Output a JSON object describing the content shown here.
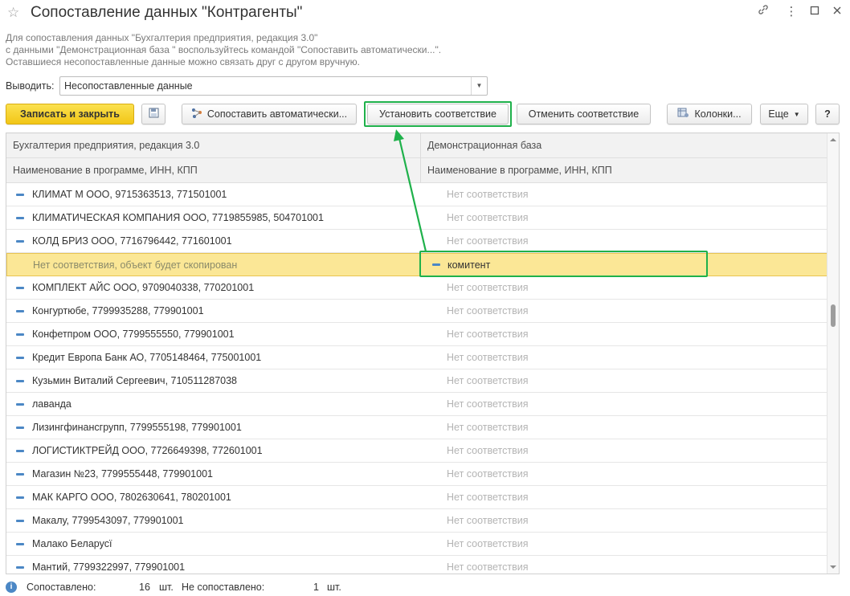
{
  "window": {
    "title": "Сопоставление данных \"Контрагенты\"",
    "star_icon": "star-icon",
    "link_icon": "link-icon",
    "more_icon": "more-icon",
    "maximize_icon": "maximize-icon",
    "close_icon": "close-icon"
  },
  "description": {
    "line1": "Для сопоставления данных \"Бухгалтерия предприятия, редакция 3.0\"",
    "line2": "с данными \"Демонстрационная база \" воспользуйтесь командой \"Сопоставить автоматически...\".",
    "line3": "Оставшиеся несопоставленные данные можно связать друг с другом вручную."
  },
  "filter": {
    "label": "Выводить:",
    "value": "Несопоставленные данные"
  },
  "toolbar": {
    "save_close": "Записать и закрыть",
    "auto_match": "Сопоставить автоматически...",
    "set_match": "Установить соответствие",
    "cancel_match": "Отменить соответствие",
    "columns": "Колонки...",
    "more": "Еще",
    "help": "?"
  },
  "grid": {
    "header1": {
      "left": "Бухгалтерия предприятия, редакция 3.0",
      "right": "Демонстрационная база"
    },
    "header2": {
      "left": "Наименование в программе, ИНН, КПП",
      "right": "Наименование в программе, ИНН, КПП"
    },
    "rows": [
      {
        "left": "КЛИМАТ М ООО, 9715363513, 771501001",
        "right": "Нет соответствия"
      },
      {
        "left": "КЛИМАТИЧЕСКАЯ КОМПАНИЯ ООО, 7719855985, 504701001",
        "right": "Нет соответствия"
      },
      {
        "left": "КОЛД БРИЗ ООО, 7716796442, 771601001",
        "right": "Нет соответствия"
      },
      {
        "left": "Нет соответствия, объект будет скопирован",
        "right": "комитент",
        "selected": true
      },
      {
        "left": "КОМПЛЕКТ АЙС ООО, 9709040338, 770201001",
        "right": "Нет соответствия"
      },
      {
        "left": "Конгуртюбе, 7799935288, 779901001",
        "right": "Нет соответствия"
      },
      {
        "left": "Конфетпром ООО, 7799555550, 779901001",
        "right": "Нет соответствия"
      },
      {
        "left": "Кредит Европа Банк АО, 7705148464, 775001001",
        "right": "Нет соответствия"
      },
      {
        "left": "Кузьмин Виталий Сергеевич, 710511287038",
        "right": "Нет соответствия"
      },
      {
        "left": "лаванда",
        "right": "Нет соответствия"
      },
      {
        "left": "Лизингфинансгрупп, 7799555198, 779901001",
        "right": "Нет соответствия"
      },
      {
        "left": "ЛОГИСТИКТРЕЙД ООО, 7726649398, 772601001",
        "right": "Нет соответствия"
      },
      {
        "left": "Магазин №23, 7799555448, 779901001",
        "right": "Нет соответствия"
      },
      {
        "left": "МАК КАРГО ООО, 7802630641, 780201001",
        "right": "Нет соответствия"
      },
      {
        "left": "Макалу, 7799543097, 779901001",
        "right": "Нет соответствия"
      },
      {
        "left": "Малако Беларусї",
        "right": "Нет соответствия"
      },
      {
        "left": "Мантий, 7799322997, 779901001",
        "right": "Нет соответствия"
      }
    ]
  },
  "status": {
    "matched_label": "Сопоставлено:",
    "matched_count": "16",
    "matched_unit": "шт.",
    "unmatched_label": "Не сопоставлено:",
    "unmatched_count": "1",
    "unmatched_unit": "шт."
  },
  "colors": {
    "primary_button": "#f2c617",
    "selection": "#fbe796",
    "annotation": "#1fb14b",
    "marker": "#4b87c5"
  }
}
